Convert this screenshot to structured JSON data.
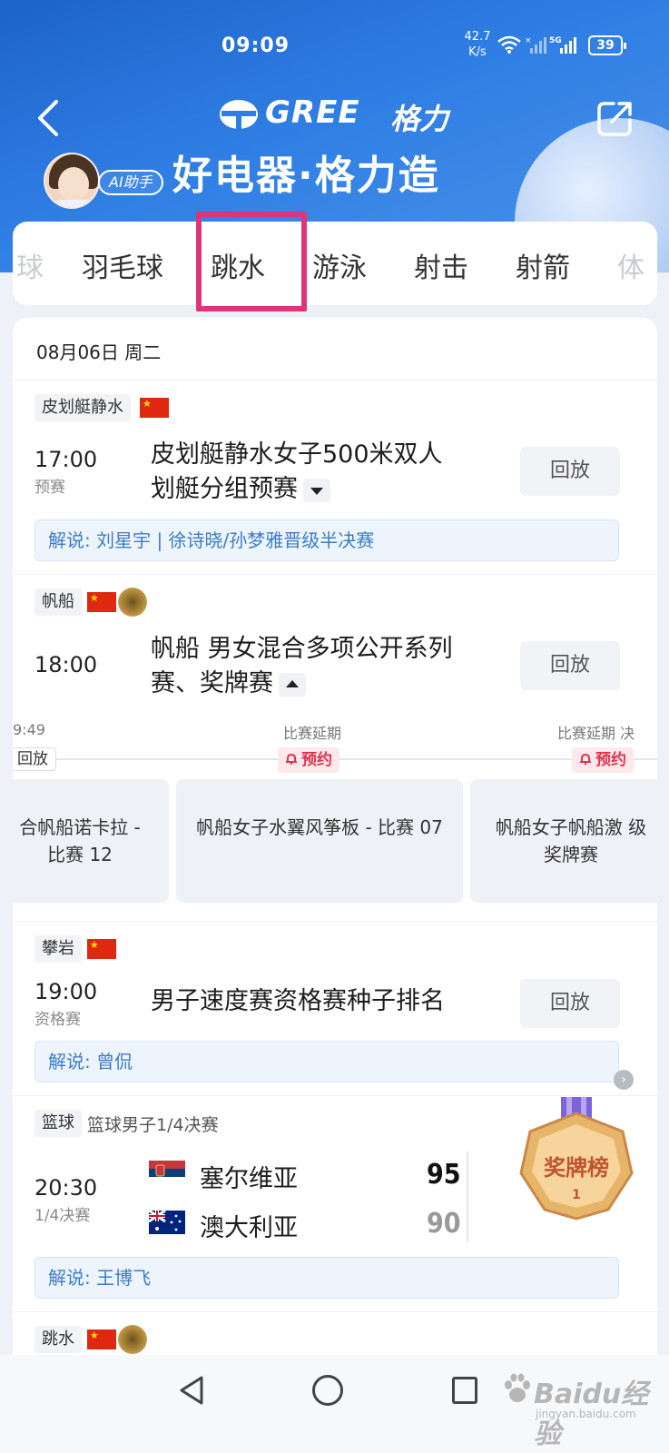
{
  "status_bar": {
    "time": "09:09",
    "net_speed_value": "42.7",
    "net_speed_unit": "K/s",
    "signal_label": "5G",
    "battery": "39"
  },
  "header": {
    "logo_text": "GREE",
    "logo_cn": "格力",
    "slogan": "好电器·格力造",
    "ai_badge": "AI助手"
  },
  "tabs": [
    {
      "label": "球",
      "state": "faded"
    },
    {
      "label": "羽毛球",
      "state": "normal"
    },
    {
      "label": "跳水",
      "state": "highlighted"
    },
    {
      "label": "游泳",
      "state": "normal"
    },
    {
      "label": "射击",
      "state": "normal"
    },
    {
      "label": "射箭",
      "state": "normal"
    },
    {
      "label": "体",
      "state": "faded"
    }
  ],
  "schedule": {
    "date": "08月06日 周二",
    "events": [
      {
        "sport_tag": "皮划艇静水",
        "time": "17:00",
        "stage": "预赛",
        "title_line1": "皮划艇静水女子500米双人",
        "title_line2": "划艇分组预赛",
        "replay_label": "回放",
        "commentary": "解说: 刘星宇 | 徐诗晓/孙梦雅晋级半决赛"
      },
      {
        "sport_tag": "帆船",
        "time": "18:00",
        "title_line1": "帆船 男女混合多项公开系列",
        "title_line2": "赛、奖牌赛",
        "replay_label": "回放",
        "sub_events": [
          {
            "time_label": "9:49",
            "action": "回放",
            "title": "合帆船诺卡拉 - 比赛 12"
          },
          {
            "time_label": "比赛延期",
            "action": "预约",
            "title": "帆船女子水翼风筝板 - 比赛 07"
          },
          {
            "time_label": "比赛延期 决",
            "action": "预约",
            "title": "帆船女子帆船激 级奖牌赛"
          }
        ]
      },
      {
        "sport_tag": "攀岩",
        "time": "19:00",
        "stage": "资格赛",
        "title_line1": "男子速度赛资格赛种子排名",
        "replay_label": "回放",
        "commentary": "解说: 曾侃"
      },
      {
        "sport_tag": "篮球",
        "sub_title": "篮球男子1/4决赛",
        "time": "20:30",
        "stage": "1/4决赛",
        "teams": [
          {
            "name": "塞尔维亚",
            "score": 95
          },
          {
            "name": "澳大利亚",
            "score": 90
          }
        ],
        "commentary": "解说: 王博飞"
      },
      {
        "sport_tag": "跳水"
      }
    ]
  },
  "medal_badge": {
    "label": "奖牌榜",
    "rank": "1"
  },
  "colors": {
    "header_blue": "#1d63c9",
    "highlight_box": "#e0347a",
    "commentary_text": "#3c7dc4",
    "reserve_red": "#e0344e",
    "flag_red": "#de2910"
  },
  "watermark": {
    "main": "Baidu经验",
    "sub": "jingyan.baidu.com"
  }
}
